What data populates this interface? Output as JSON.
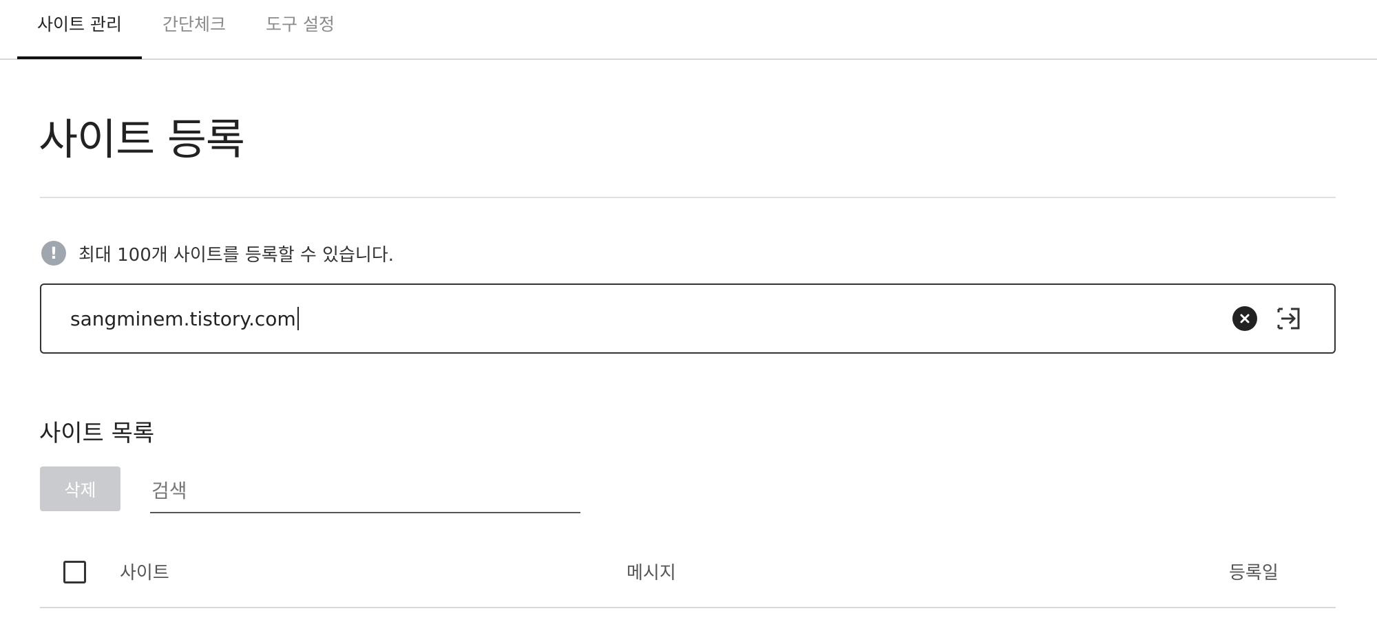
{
  "tabs": [
    {
      "label": "사이트 관리",
      "active": true
    },
    {
      "label": "간단체크",
      "active": false
    },
    {
      "label": "도구 설정",
      "active": false
    }
  ],
  "page": {
    "title": "사이트 등록"
  },
  "notice": {
    "icon": "info-icon",
    "text": "최대 100개 사이트를 등록할 수 있습니다."
  },
  "url_input": {
    "value": "sangminem.tistory.com",
    "clear_icon": "clear-icon",
    "submit_icon": "submit-icon"
  },
  "site_list": {
    "title": "사이트 목록",
    "delete_label": "삭제",
    "search_placeholder": "검색",
    "columns": {
      "site": "사이트",
      "message": "메시지",
      "date": "등록일"
    }
  },
  "colors": {
    "accent": "#111111",
    "disabled_button": "#c9cbce",
    "info_icon": "#9fa6ad"
  }
}
